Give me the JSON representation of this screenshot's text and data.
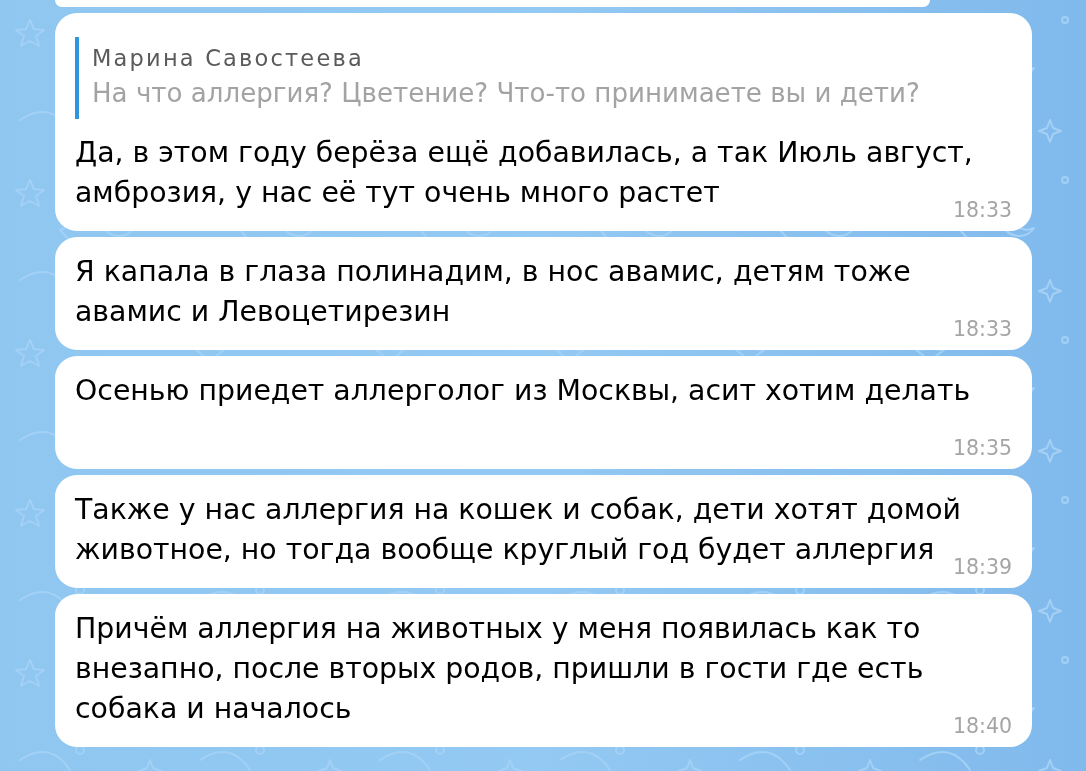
{
  "messages": [
    {
      "reply": {
        "author": "Марина Савостеева",
        "text": "На что аллергия? Цветение? Что-то принимаете вы и дети?"
      },
      "text": "Да, в этом году берёза ещё добавилась, а так Июль август, амброзия, у нас её тут очень много растет",
      "time": "18:33"
    },
    {
      "text": "Я капала в глаза полинадим, в нос авамис, детям тоже авамис и Левоцетирезин",
      "time": "18:33"
    },
    {
      "text": "Осенью приедет аллерголог из Москвы, асит хотим делать",
      "time": "18:35"
    },
    {
      "text": "Также у нас аллергия на кошек и собак, дети хотят домой животное, но тогда вообще круглый год будет аллергия",
      "time": "18:39"
    },
    {
      "text": "Причём аллергия на животных у меня появилась как то внезапно, после вторых родов, пришли в гости где есть собака и началось",
      "time": "18:40"
    }
  ]
}
